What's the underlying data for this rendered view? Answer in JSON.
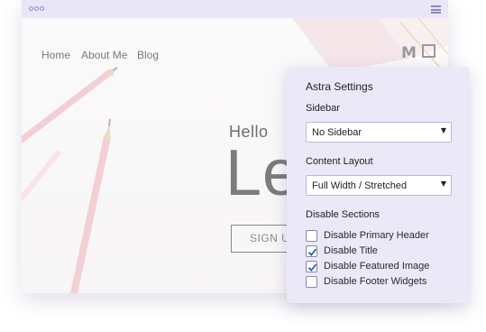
{
  "site": {
    "nav": [
      "Home",
      "About Me",
      "Blog"
    ],
    "logo_letter": "M",
    "hero_greeting": "Hello",
    "hero_heading": "Le",
    "hero_button": "SIGN U"
  },
  "panel": {
    "title": "Astra Settings",
    "sidebar_label": "Sidebar",
    "sidebar_value": "No Sidebar",
    "content_layout_label": "Content Layout",
    "content_layout_value": "Full Width / Stretched",
    "disable_sections_label": "Disable Sections",
    "options": [
      {
        "label": "Disable Primary Header",
        "checked": false
      },
      {
        "label": "Disable Title",
        "checked": true
      },
      {
        "label": "Disable Featured Image",
        "checked": true
      },
      {
        "label": "Disable Footer Widgets",
        "checked": false
      }
    ]
  },
  "colors": {
    "accent": "#8f85c9",
    "panel_bg": "#ebe8f8",
    "check": "#1d63b8"
  },
  "icons": {
    "window_dots": "window-dots-icon",
    "menu": "hamburger-menu-icon",
    "select_arrow": "caret-down-icon",
    "checkmark": "checkmark-icon"
  }
}
